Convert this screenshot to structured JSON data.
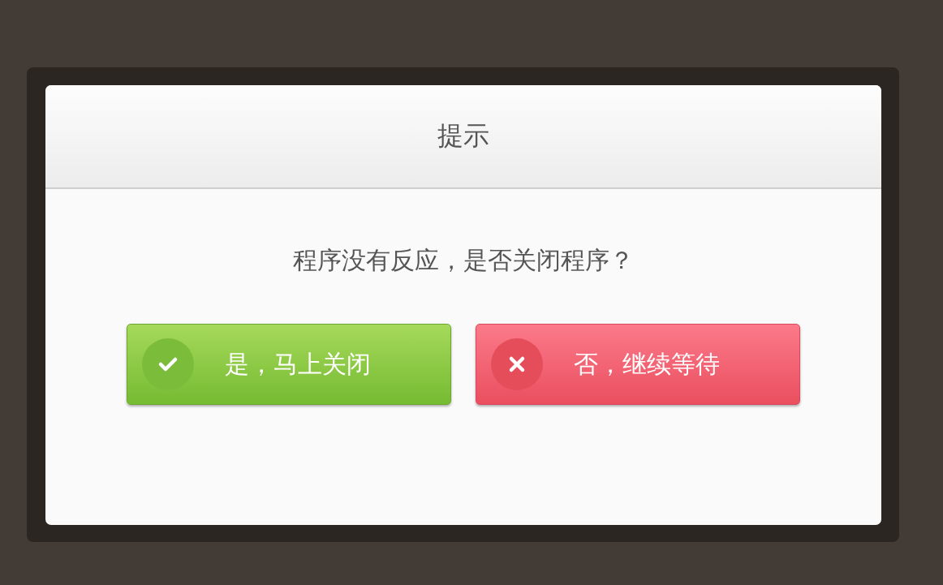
{
  "dialog": {
    "title": "提示",
    "message": "程序没有反应，是否关闭程序？",
    "buttons": [
      {
        "label": "是，马上关闭",
        "kind": "confirm"
      },
      {
        "label": "否，继续等待",
        "kind": "cancel"
      }
    ]
  }
}
